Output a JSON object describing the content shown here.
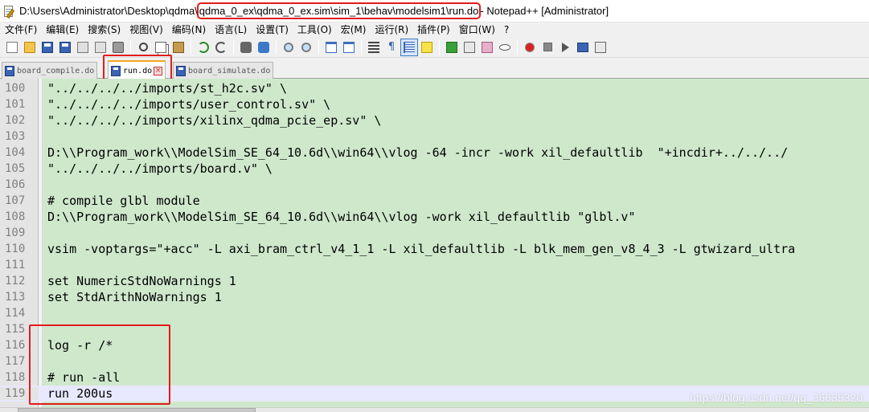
{
  "window": {
    "title_prefix": "D:\\Users\\Administrator\\Desktop\\qdma\\",
    "title_path": "qdma_0_ex\\qdma_0_ex.sim\\sim_1\\behav\\modelsim1\\run.do",
    "title_suffix": " - Notepad++ [Administrator]"
  },
  "menu": [
    "文件(F)",
    "编辑(E)",
    "搜索(S)",
    "视图(V)",
    "编码(N)",
    "语言(L)",
    "设置(T)",
    "工具(O)",
    "宏(M)",
    "运行(R)",
    "插件(P)",
    "窗口(W)",
    "?"
  ],
  "toolbar": {
    "icons": [
      "new-file-icon",
      "open-folder-icon",
      "save-icon",
      "save-all-icon",
      "close-icon",
      "close-all-icon",
      "print-icon",
      "cut-icon",
      "copy-icon",
      "paste-icon",
      "undo-icon",
      "redo-icon",
      "find-icon",
      "replace-icon",
      "zoom-in-icon",
      "zoom-out-icon",
      "sync-vertical-icon",
      "sync-horizontal-icon",
      "word-wrap-icon",
      "show-all-chars-icon",
      "indent-guide-icon",
      "language-icon",
      "doc-map-icon",
      "function-list-icon",
      "folder-workspace-icon",
      "monitor-icon",
      "record-macro-icon",
      "stop-macro-icon",
      "play-macro-icon",
      "play-multiple-icon",
      "save-macro-icon"
    ]
  },
  "tabs": [
    {
      "label": "board_compile.do",
      "active": false
    },
    {
      "label": "run.do",
      "active": true
    },
    {
      "label": "board_simulate.do",
      "active": false
    }
  ],
  "editor": {
    "current_line": "119",
    "lines": [
      {
        "n": "100",
        "text": "\"../../../../imports/st_h2c.sv\" \\"
      },
      {
        "n": "101",
        "text": "\"../../../../imports/user_control.sv\" \\"
      },
      {
        "n": "102",
        "text": "\"../../../../imports/xilinx_qdma_pcie_ep.sv\" \\"
      },
      {
        "n": "103",
        "text": ""
      },
      {
        "n": "104",
        "text": "D:\\\\Program_work\\\\ModelSim_SE_64_10.6d\\\\win64\\\\vlog -64 -incr -work xil_defaultlib  \"+incdir+../../../"
      },
      {
        "n": "105",
        "text": "\"../../../../imports/board.v\" \\"
      },
      {
        "n": "106",
        "text": ""
      },
      {
        "n": "107",
        "text": "# compile glbl module"
      },
      {
        "n": "108",
        "text": "D:\\\\Program_work\\\\ModelSim_SE_64_10.6d\\\\win64\\\\vlog -work xil_defaultlib \"glbl.v\""
      },
      {
        "n": "109",
        "text": ""
      },
      {
        "n": "110",
        "text": "vsim -voptargs=\"+acc\" -L axi_bram_ctrl_v4_1_1 -L xil_defaultlib -L blk_mem_gen_v8_4_3 -L gtwizard_ultra"
      },
      {
        "n": "111",
        "text": ""
      },
      {
        "n": "112",
        "text": "set NumericStdNoWarnings 1"
      },
      {
        "n": "113",
        "text": "set StdArithNoWarnings 1"
      },
      {
        "n": "114",
        "text": ""
      },
      {
        "n": "115",
        "text": ""
      },
      {
        "n": "116",
        "text": "log -r /*"
      },
      {
        "n": "117",
        "text": ""
      },
      {
        "n": "118",
        "text": "# run -all"
      },
      {
        "n": "119",
        "text": "run 200us"
      }
    ]
  },
  "watermark": "https://blog.csdn.net/qq_36635320",
  "colors": {
    "highlight_red": "#e21b1b",
    "editor_bg": "#cfe8cc",
    "current_line_bg": "#e8e8ff",
    "active_tab_accent": "#f5a623"
  }
}
